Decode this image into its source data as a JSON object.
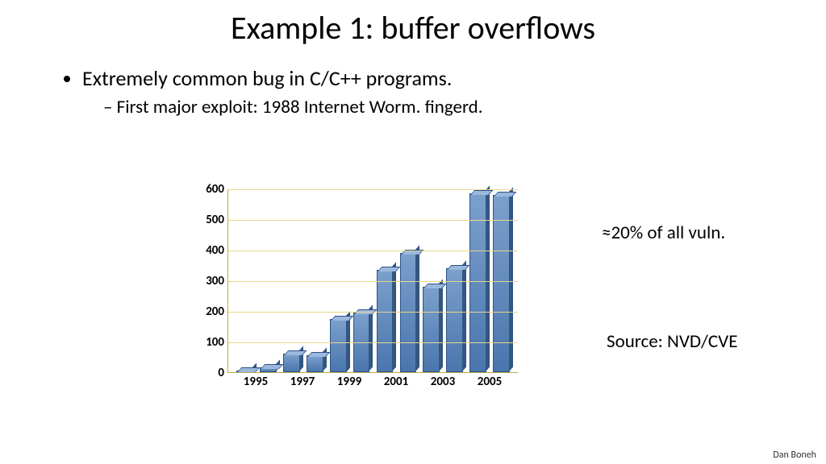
{
  "title": "Example 1:   buffer overflows",
  "bullets": {
    "main": "Extremely common bug in C/C++ programs.",
    "sub": "First major exploit:  1988 Internet Worm.   fingerd."
  },
  "annotations": {
    "pct": "≈20% of all vuln.",
    "source": "Source:  NVD/CVE"
  },
  "footer": "Dan Boneh",
  "chart_data": {
    "type": "bar",
    "categories": [
      "1995",
      "1996",
      "1997",
      "1998",
      "1999",
      "2000",
      "2001",
      "2002",
      "2003",
      "2004",
      "2005",
      "2006"
    ],
    "values": [
      5,
      15,
      60,
      55,
      175,
      195,
      335,
      390,
      280,
      340,
      585,
      580
    ],
    "x_tick_labels": [
      "1995",
      "1997",
      "1999",
      "2001",
      "2003",
      "2005"
    ],
    "y_ticks": [
      0,
      100,
      200,
      300,
      400,
      500,
      600
    ],
    "ylim": [
      0,
      600
    ],
    "title": "",
    "xlabel": "",
    "ylabel": ""
  }
}
